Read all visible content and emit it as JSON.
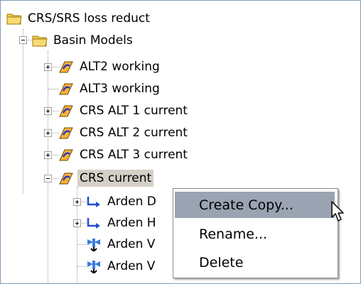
{
  "tree": {
    "root": {
      "label": "CRS/SRS loss reduct",
      "icon": "folder-open-icon"
    },
    "basin_models": {
      "label": "Basin Models",
      "icon": "folder-open-icon"
    },
    "items": [
      {
        "label": "ALT2 working",
        "icon": "basin-model-icon"
      },
      {
        "label": "ALT3 working",
        "icon": "basin-model-icon"
      },
      {
        "label": "CRS ALT 1 current",
        "icon": "basin-model-icon"
      },
      {
        "label": "CRS ALT 2 current",
        "icon": "basin-model-icon"
      },
      {
        "label": "CRS ALT 3 current",
        "icon": "basin-model-icon"
      },
      {
        "label": "CRS current",
        "icon": "basin-model-icon"
      }
    ],
    "children": [
      {
        "label": "Arden D",
        "icon": "reach-icon"
      },
      {
        "label": "Arden H",
        "icon": "reach-icon"
      },
      {
        "label": "Arden V",
        "icon": "junction-icon"
      },
      {
        "label": "Arden V",
        "icon": "junction-icon"
      }
    ]
  },
  "context_menu": {
    "items": [
      {
        "label": "Create Copy..."
      },
      {
        "label": "Rename..."
      },
      {
        "label": "Delete"
      }
    ]
  },
  "colors": {
    "folder": "#f2c646",
    "menu_highlight": "#9aa3b2",
    "selection": "#d4d0c8"
  }
}
